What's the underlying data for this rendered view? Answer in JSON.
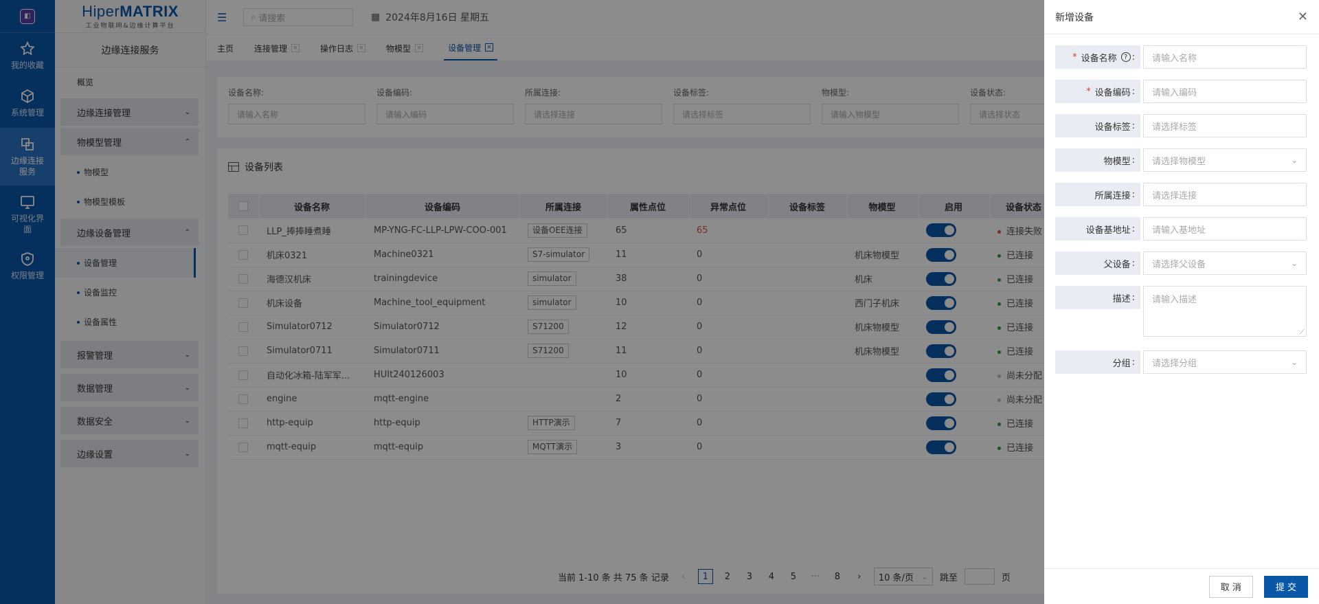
{
  "rail": {
    "items": [
      {
        "label": "我的收藏",
        "icon": "star-icon"
      },
      {
        "label": "系统管理",
        "icon": "cube-icon"
      },
      {
        "label": "边缘连接服务",
        "icon": "link-icon"
      },
      {
        "label": "可视化界面",
        "icon": "monitor-icon"
      },
      {
        "label": "权限管理",
        "icon": "shield-icon"
      }
    ]
  },
  "brand": {
    "name_light": "Hiper",
    "name_bold": "MATRIX",
    "tagline": "工业物联网&边缘计算平台"
  },
  "sidebar": {
    "title": "边缘连接服务",
    "overview": "概览",
    "groups": [
      {
        "label": "边缘连接管理"
      },
      {
        "label": "物模型管理",
        "subs": [
          "物模型",
          "物模型模板"
        ]
      },
      {
        "label": "边缘设备管理",
        "subs": [
          "设备管理",
          "设备监控",
          "设备属性"
        ]
      },
      {
        "label": "报警管理"
      },
      {
        "label": "数据管理"
      },
      {
        "label": "数据安全"
      },
      {
        "label": "边缘设置"
      }
    ]
  },
  "topbar": {
    "search_placeholder": "请搜索",
    "date": "2024年8月16日 星期五"
  },
  "tabs": [
    "主页",
    "连接管理",
    "操作日志",
    "物模型",
    "设备管理"
  ],
  "filters": [
    {
      "label": "设备名称:",
      "placeholder": "请输入名称"
    },
    {
      "label": "设备编码:",
      "placeholder": "请输入编码"
    },
    {
      "label": "所属连接:",
      "placeholder": "请选择连接"
    },
    {
      "label": "设备标签:",
      "placeholder": "请选择标签"
    },
    {
      "label": "物模型:",
      "placeholder": "请输入物模型"
    },
    {
      "label": "设备状态:",
      "placeholder": "请选择状态"
    }
  ],
  "list": {
    "title": "设备列表",
    "columns": [
      "设备名称",
      "设备编码",
      "所属连接",
      "属性点位",
      "异常点位",
      "设备标签",
      "物模型",
      "启用",
      "设备状态"
    ],
    "rows": [
      {
        "name": "LLP_捧捧睡煮睡",
        "code": "MP-YNG-FC-LLP-LPW-COO-001",
        "conn": "设备OEE连接",
        "attrs": "65",
        "errs": "65",
        "tag": "",
        "model": "",
        "status": "连接失败"
      },
      {
        "name": "机床0321",
        "code": "Machine0321",
        "conn": "S7-simulator",
        "attrs": "11",
        "errs": "0",
        "tag": "",
        "model": "机床物模型",
        "status": "已连接"
      },
      {
        "name": "海德汉机床",
        "code": "trainingdevice",
        "conn": "simulator",
        "attrs": "38",
        "errs": "0",
        "tag": "",
        "model": "机床",
        "status": "已连接"
      },
      {
        "name": "机床设备",
        "code": "Machine_tool_equipment",
        "conn": "simulator",
        "attrs": "10",
        "errs": "0",
        "tag": "",
        "model": "西门子机床",
        "status": "已连接"
      },
      {
        "name": "Simulator0712",
        "code": "Simulator0712",
        "conn": "S71200",
        "attrs": "12",
        "errs": "0",
        "tag": "",
        "model": "机床物模型",
        "status": "已连接"
      },
      {
        "name": "Simulator0711",
        "code": "Simulator0711",
        "conn": "S71200",
        "attrs": "11",
        "errs": "0",
        "tag": "",
        "model": "机床物模型",
        "status": "已连接"
      },
      {
        "name": "自动化冰箱-陆军军...",
        "code": "HUIt240126003",
        "conn": "",
        "attrs": "10",
        "errs": "0",
        "tag": "",
        "model": "",
        "status": "尚未分配"
      },
      {
        "name": "engine",
        "code": "mqtt-engine",
        "conn": "",
        "attrs": "2",
        "errs": "0",
        "tag": "",
        "model": "",
        "status": "尚未分配"
      },
      {
        "name": "http-equip",
        "code": "http-equip",
        "conn": "HTTP演示",
        "attrs": "7",
        "errs": "0",
        "tag": "",
        "model": "",
        "status": "已连接"
      },
      {
        "name": "mqtt-equip",
        "code": "mqtt-equip",
        "conn": "MQTT演示",
        "attrs": "3",
        "errs": "0",
        "tag": "",
        "model": "",
        "status": "已连接"
      }
    ]
  },
  "pager": {
    "summary": "当前 1-10 条 共 75 条 记录",
    "pages": [
      "1",
      "2",
      "3",
      "4",
      "5"
    ],
    "ellipsis": "···",
    "last": "8",
    "page_size": "10 条/页",
    "jump_label": "跳至",
    "page_unit": "页"
  },
  "drawer": {
    "title": "新增设备",
    "fields": [
      {
        "label": "设备名称",
        "required": true,
        "help": true,
        "placeholder": "请输入名称",
        "type": "input"
      },
      {
        "label": "设备编码",
        "required": true,
        "placeholder": "请输入编码",
        "type": "input"
      },
      {
        "label": "设备标签",
        "placeholder": "请选择标签",
        "type": "input"
      },
      {
        "label": "物模型",
        "placeholder": "请选择物模型",
        "type": "select"
      },
      {
        "label": "所属连接",
        "placeholder": "请选择连接",
        "type": "input"
      },
      {
        "label": "设备基地址",
        "placeholder": "请输入基地址",
        "type": "input"
      },
      {
        "label": "父设备",
        "placeholder": "请选择父设备",
        "type": "select"
      },
      {
        "label": "描述",
        "placeholder": "请输入描述",
        "type": "textarea"
      },
      {
        "label": "分组",
        "placeholder": "请选择分组",
        "type": "select"
      }
    ],
    "cancel": "取 消",
    "submit": "提 交"
  },
  "colors": {
    "primary": "#0a57a8",
    "danger": "#d9534f",
    "success": "#2e9d3a",
    "unassigned": "#bbbbbb"
  }
}
